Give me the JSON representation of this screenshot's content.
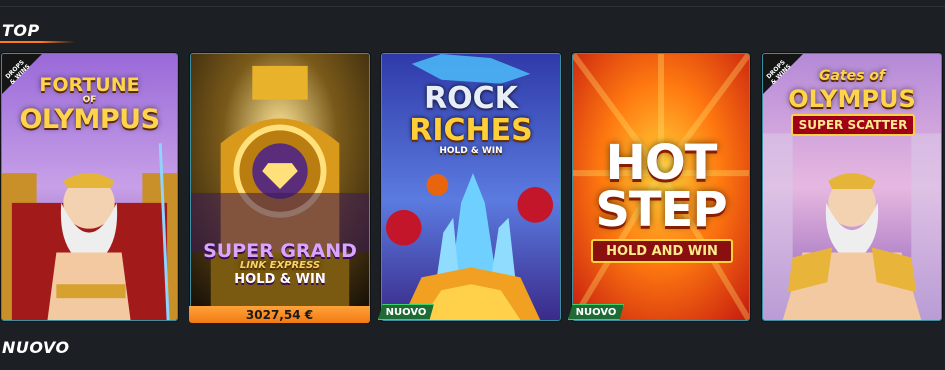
{
  "sections": {
    "top_title": "TOP",
    "nuovo_title": "NUOVO"
  },
  "games": [
    {
      "title_lines": [
        "FORTUNE",
        "OF",
        "OLYMPUS"
      ],
      "badge": "DROPS & WINS"
    },
    {
      "title_lines": [
        "SUPER GRAND",
        "LINK EXPRESS",
        "HOLD & WIN"
      ],
      "jackpot": "3027,54 €"
    },
    {
      "title_lines": [
        "ROCK",
        "RICHES",
        "HOLD & WIN"
      ],
      "new_badge": "NUOVO"
    },
    {
      "title_lines": [
        "HOT",
        "STEP"
      ],
      "subtitle": "HOLD AND WIN",
      "new_badge": "NUOVO"
    },
    {
      "title_lines": [
        "Gates of",
        "OLYMPUS",
        "SUPER SCATTER"
      ],
      "badge": "DROPS & WINS"
    }
  ],
  "colors": {
    "background": "#1c2024",
    "accent_orange": "#ff7a1a",
    "new_badge_green": "#1e6b35",
    "card_border": "#3a8fa0"
  },
  "icons": [
    "drops-and-wins-badge-icon",
    "zeus-character-icon",
    "train-icon",
    "crystal-icon",
    "gem-icon"
  ]
}
